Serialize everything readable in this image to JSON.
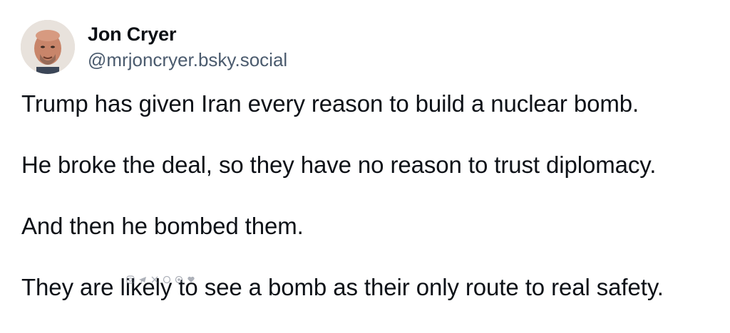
{
  "post": {
    "author": {
      "display_name": "Jon Cryer",
      "handle": "@mrjoncryer.bsky.social",
      "avatar_icon": "profile-photo"
    },
    "paragraphs": [
      "Trump has given Iran every reason to build a nuclear bomb.",
      "He broke the deal, so they have no reason to trust diplomacy.",
      "And then he bombed them.",
      "They are likely to see a bomb as their only route to real safety."
    ]
  },
  "watermark": {
    "icons": [
      "instagram-icon",
      "telegram-icon",
      "x-icon",
      "threads-icon",
      "bluesky-icon",
      "heart-icon"
    ]
  },
  "colors": {
    "text": "#0d1117",
    "handle": "#4b5b6e",
    "background": "#ffffff"
  }
}
